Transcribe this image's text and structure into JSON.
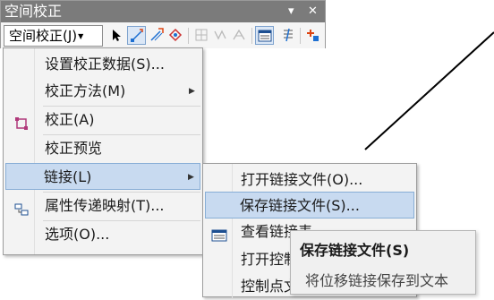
{
  "toolbar": {
    "title": "空间校正",
    "controls": {
      "dropdown": "▾",
      "close": "✕"
    },
    "menu_label": "空间校正(J)",
    "menu_caret": "▼",
    "tools": [
      "select-arrow-icon",
      "new-link-icon",
      "multi-link-icon",
      "identity-link-icon",
      "limited-adjust-icon",
      "displacement-link-icon",
      "grid-link-icon",
      "link-table-icon",
      "adjust-preview-icon",
      "attribute-transfer-icon"
    ]
  },
  "menu": {
    "items": [
      {
        "label": "设置校正数据(S)...",
        "icon": ""
      },
      {
        "label": "校正方法(M)",
        "submenu_arrow": "▶"
      },
      {
        "label": "校正(A)",
        "icon": "adjust-icon"
      },
      {
        "label": "校正预览",
        "icon": ""
      },
      {
        "label": "链接(L)",
        "submenu_arrow": "▶"
      },
      {
        "label": "属性传递映射(T)...",
        "icon": "attribute-mapping-icon"
      },
      {
        "label": "选项(O)...",
        "icon": ""
      }
    ]
  },
  "submenu": {
    "items": [
      {
        "label": "打开链接文件(O)..."
      },
      {
        "label": "保存链接文件(S)..."
      },
      {
        "label": "查看链接表",
        "icon": "link-table-icon"
      },
      {
        "label": "打开控制点文件"
      },
      {
        "label": "控制点文件"
      }
    ]
  },
  "tooltip": {
    "title": "保存链接文件(S)",
    "description": "将位移链接保存到文本"
  },
  "colors": {
    "titlebar": "#7b7b7b",
    "highlight": "#c8daf0",
    "highlight_border": "#88aed6",
    "menu_bg": "#f3f3f3"
  }
}
